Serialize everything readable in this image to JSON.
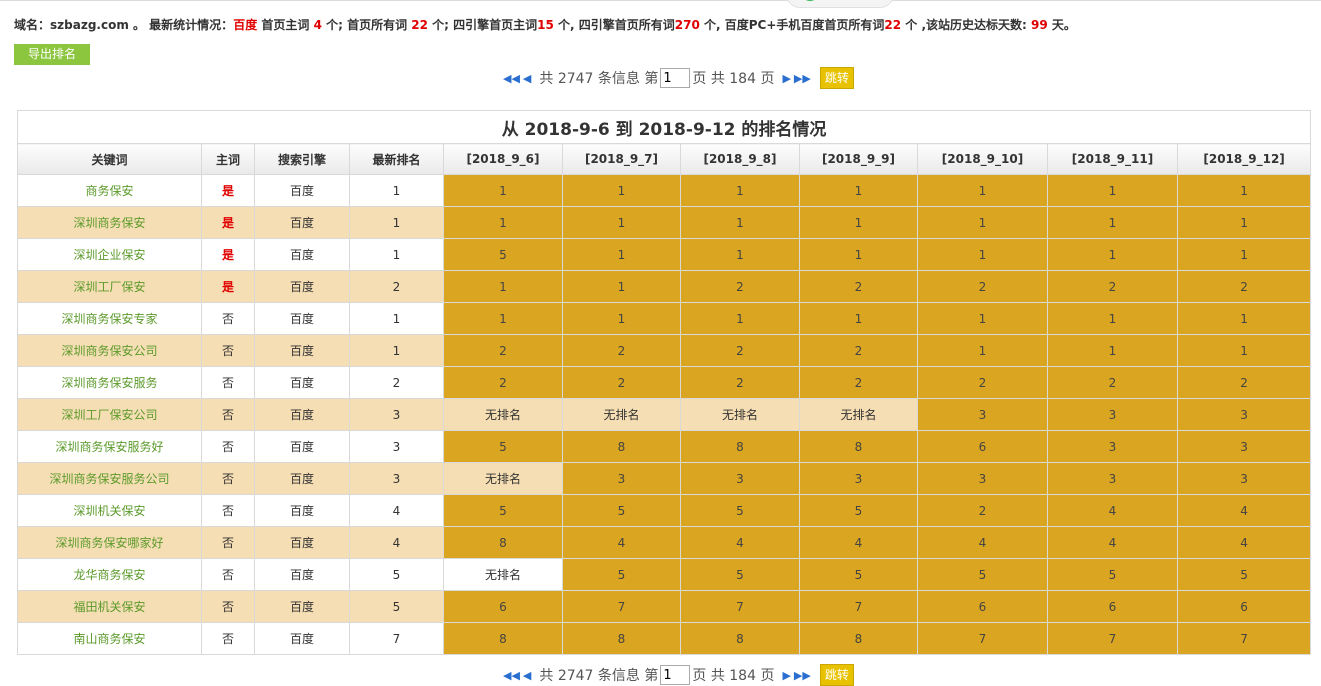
{
  "stats": {
    "domain_label": "域名：",
    "domain": "szbazg.com",
    "sep1": " 。 最新统计情况：",
    "engine": "百度",
    "t1": " 首页主词 ",
    "main_home": "4",
    "t2": " 个; 首页所有词 ",
    "all_home": "22",
    "t3": " 个; 四引擎首页主词",
    "four_main": "15",
    "t4": " 个, 四引擎首页所有词",
    "four_all": "270",
    "t5": " 个, 百度PC+手机百度首页所有词",
    "pc_mobile": "22",
    "t6": " 个 ,该站历史达标天数: ",
    "days": "99",
    "t7": " 天。"
  },
  "export_label": "导出排名",
  "pager": {
    "total_text": "共 2747 条信息 第",
    "page_value": "1",
    "pages_text": "页 共 184 页",
    "jump_label": "跳转"
  },
  "table": {
    "caption": "从 2018-9-6 到 2018-9-12 的排名情况",
    "headers": [
      "关键词",
      "主词",
      "搜索引擎",
      "最新排名",
      "[2018_9_6]",
      "[2018_9_7]",
      "[2018_9_8]",
      "[2018_9_9]",
      "[2018_9_10]",
      "[2018_9_11]",
      "[2018_9_12]"
    ],
    "rows": [
      {
        "kw": "商务保安",
        "main": "是",
        "eng": "百度",
        "latest": "1",
        "r": [
          "1",
          "1",
          "1",
          "1",
          "1",
          "1",
          "1"
        ]
      },
      {
        "kw": "深圳商务保安",
        "main": "是",
        "eng": "百度",
        "latest": "1",
        "r": [
          "1",
          "1",
          "1",
          "1",
          "1",
          "1",
          "1"
        ]
      },
      {
        "kw": "深圳企业保安",
        "main": "是",
        "eng": "百度",
        "latest": "1",
        "r": [
          "5",
          "1",
          "1",
          "1",
          "1",
          "1",
          "1"
        ]
      },
      {
        "kw": "深圳工厂保安",
        "main": "是",
        "eng": "百度",
        "latest": "2",
        "r": [
          "1",
          "1",
          "2",
          "2",
          "2",
          "2",
          "2"
        ]
      },
      {
        "kw": "深圳商务保安专家",
        "main": "否",
        "eng": "百度",
        "latest": "1",
        "r": [
          "1",
          "1",
          "1",
          "1",
          "1",
          "1",
          "1"
        ]
      },
      {
        "kw": "深圳商务保安公司",
        "main": "否",
        "eng": "百度",
        "latest": "1",
        "r": [
          "2",
          "2",
          "2",
          "2",
          "1",
          "1",
          "1"
        ]
      },
      {
        "kw": "深圳商务保安服务",
        "main": "否",
        "eng": "百度",
        "latest": "2",
        "r": [
          "2",
          "2",
          "2",
          "2",
          "2",
          "2",
          "2"
        ]
      },
      {
        "kw": "深圳工厂保安公司",
        "main": "否",
        "eng": "百度",
        "latest": "3",
        "r": [
          "无排名",
          "无排名",
          "无排名",
          "无排名",
          "3",
          "3",
          "3"
        ]
      },
      {
        "kw": "深圳商务保安服务好",
        "main": "否",
        "eng": "百度",
        "latest": "3",
        "r": [
          "5",
          "8",
          "8",
          "8",
          "6",
          "3",
          "3"
        ]
      },
      {
        "kw": "深圳商务保安服务公司",
        "main": "否",
        "eng": "百度",
        "latest": "3",
        "r": [
          "无排名",
          "3",
          "3",
          "3",
          "3",
          "3",
          "3"
        ]
      },
      {
        "kw": "深圳机关保安",
        "main": "否",
        "eng": "百度",
        "latest": "4",
        "r": [
          "5",
          "5",
          "5",
          "5",
          "2",
          "4",
          "4"
        ]
      },
      {
        "kw": "深圳商务保安哪家好",
        "main": "否",
        "eng": "百度",
        "latest": "4",
        "r": [
          "8",
          "4",
          "4",
          "4",
          "4",
          "4",
          "4"
        ]
      },
      {
        "kw": "龙华商务保安",
        "main": "否",
        "eng": "百度",
        "latest": "5",
        "r": [
          "无排名",
          "5",
          "5",
          "5",
          "5",
          "5",
          "5"
        ]
      },
      {
        "kw": "福田机关保安",
        "main": "否",
        "eng": "百度",
        "latest": "5",
        "r": [
          "6",
          "7",
          "7",
          "7",
          "6",
          "6",
          "6"
        ]
      },
      {
        "kw": "南山商务保安",
        "main": "否",
        "eng": "百度",
        "latest": "7",
        "r": [
          "8",
          "8",
          "8",
          "8",
          "7",
          "7",
          "7"
        ]
      }
    ]
  },
  "colors": {
    "ranked": "#daa520",
    "alt_row": "#f5deb3",
    "keyword": "#5c9a2b",
    "highlight": "#e00000",
    "export_btn": "#8cc63f"
  }
}
